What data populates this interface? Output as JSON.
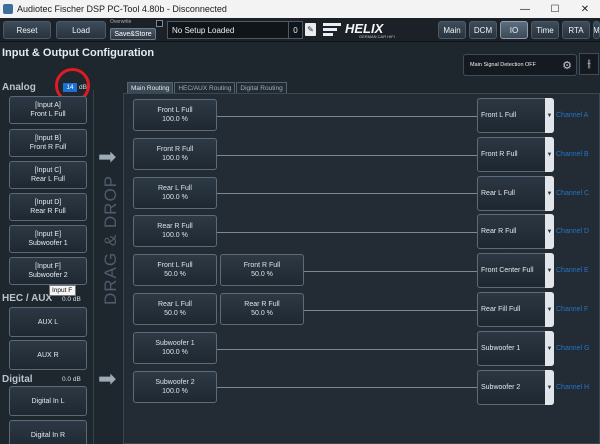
{
  "window": {
    "title": "Audiotec Fischer DSP PC-Tool 4.80b - Disconnected",
    "minimize": "—",
    "maximize": "☐",
    "close": "✕"
  },
  "toolbar": {
    "reset": "Reset",
    "load": "Load",
    "overwrite": "Overwrite",
    "save_store": "Save&Store",
    "setup_name": "No Setup Loaded",
    "setup_number": "0",
    "logo": "HELIX",
    "logo_sub": "GERMAN CAR HIFI",
    "tabs": [
      "Main",
      "DCM",
      "IO",
      "Time",
      "RTA",
      "M"
    ],
    "active_tab": "IO"
  },
  "page": {
    "title": "Input & Output Configuration",
    "main_signal_detection": "Main Signal Detection OFF",
    "tooltip": "Input F"
  },
  "analog": {
    "label": "Analog",
    "gain_value": "14",
    "gain_unit": "dB",
    "inputs": [
      {
        "name": "[Input A]",
        "label": "Front L Full"
      },
      {
        "name": "[Input B]",
        "label": "Front R Full"
      },
      {
        "name": "[Input C]",
        "label": "Rear L Full"
      },
      {
        "name": "[Input D]",
        "label": "Rear R Full"
      },
      {
        "name": "[Input E]",
        "label": "Subwoofer 1"
      },
      {
        "name": "[Input F]",
        "label": "Subwoofer 2"
      }
    ]
  },
  "hec_aux": {
    "label": "HEC / AUX",
    "gain": "0.0 dB",
    "inputs": [
      "AUX L",
      "AUX R"
    ]
  },
  "digital": {
    "label": "Digital",
    "gain": "0.0 dB",
    "inputs": [
      "Digital In L",
      "Digital In R"
    ]
  },
  "routing_tabs": [
    "Main Routing",
    "HEC/AUX Routing",
    "Digital Routing"
  ],
  "drag_drop": "DRAG & DROP",
  "sources": [
    {
      "name": "Front L Full",
      "pct": "100.0 %"
    },
    {
      "name": "Front R Full",
      "pct": "100.0 %"
    },
    {
      "name": "Rear L Full",
      "pct": "100.0 %"
    },
    {
      "name": "Rear R Full",
      "pct": "100.0 %"
    },
    {
      "name": "Front L Full",
      "pct": "50.0 %"
    },
    {
      "name": "Front R Full",
      "pct": "50.0 %"
    },
    {
      "name": "Rear L Full",
      "pct": "50.0 %"
    },
    {
      "name": "Rear R Full",
      "pct": "50.0 %"
    },
    {
      "name": "Subwoofer 1",
      "pct": "100.0 %"
    },
    {
      "name": "Subwoofer 2",
      "pct": "100.0 %"
    }
  ],
  "outputs": [
    {
      "name": "Front L Full",
      "channel": "Channel A"
    },
    {
      "name": "Front R Full",
      "channel": "Channel B"
    },
    {
      "name": "Rear L Full",
      "channel": "Channel C"
    },
    {
      "name": "Rear R Full",
      "channel": "Channel D"
    },
    {
      "name": "Front Center Full",
      "channel": "Channel E"
    },
    {
      "name": "Rear Fill Full",
      "channel": "Channel F"
    },
    {
      "name": "Subwoofer 1",
      "channel": "Channel G"
    },
    {
      "name": "Subwoofer 2",
      "channel": "Channel H"
    }
  ],
  "icons": {
    "gear": "⚙",
    "equalizer": "⫲",
    "arrow": "➡",
    "dropdown": "▼",
    "setup": "✎"
  },
  "colors": {
    "accent": "#1e6fd2",
    "highlight_circle": "#e11b22",
    "channel_label": "#1f76c8"
  }
}
